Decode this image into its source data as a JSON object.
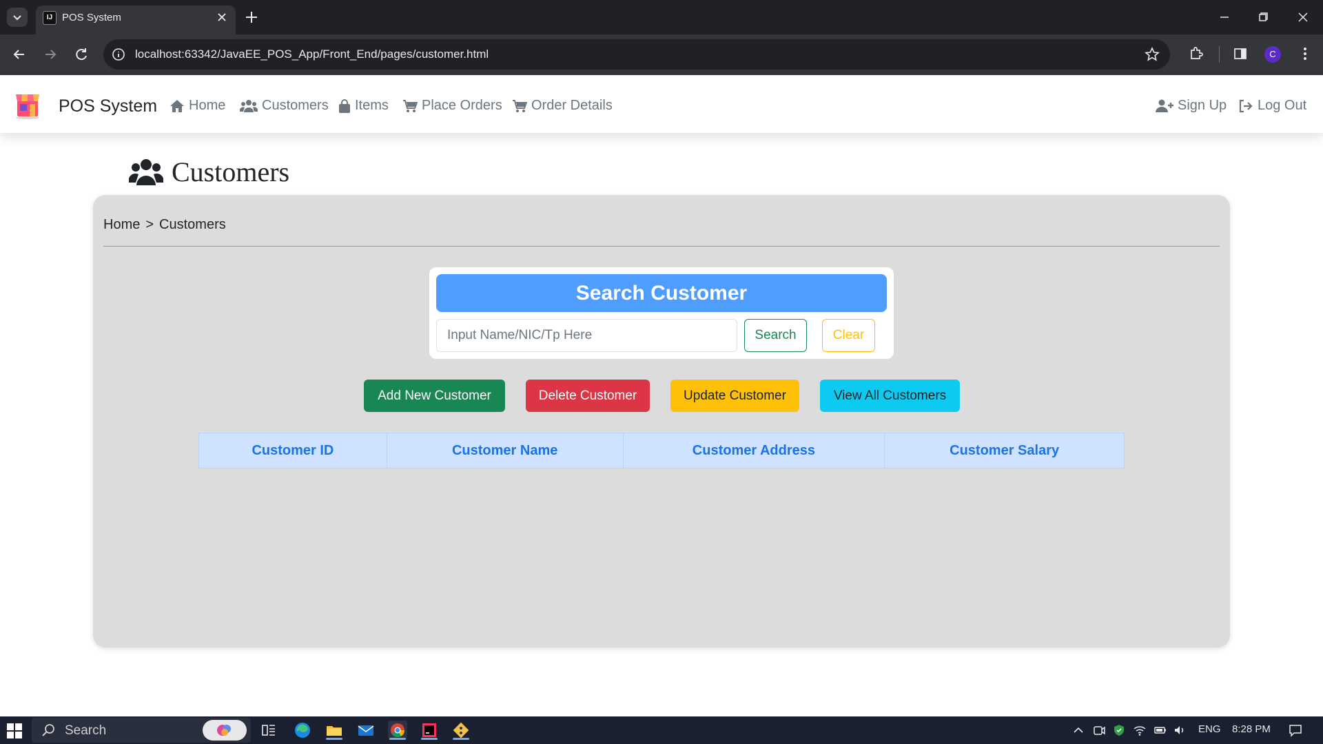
{
  "browser": {
    "tab_title": "POS System",
    "url": "localhost:63342/JavaEE_POS_App/Front_End/pages/customer.html",
    "profile_initial": "C",
    "favicon_text": "IJ"
  },
  "navbar": {
    "brand": "POS System",
    "links": [
      {
        "label": "Home",
        "icon": "home-icon"
      },
      {
        "label": "Customers",
        "icon": "users-icon"
      },
      {
        "label": "Items",
        "icon": "bag-icon"
      },
      {
        "label": "Place Orders",
        "icon": "cart-icon"
      },
      {
        "label": "Order Details",
        "icon": "cart-icon"
      }
    ],
    "right_links": [
      {
        "label": "Sign Up",
        "icon": "user-plus-icon"
      },
      {
        "label": "Log Out",
        "icon": "logout-icon"
      }
    ]
  },
  "page": {
    "title": "Customers",
    "breadcrumb": [
      "Home",
      ">",
      "Customers"
    ]
  },
  "search": {
    "header": "Search Customer",
    "placeholder": "Input Name/NIC/Tp Here",
    "value": "",
    "search_label": "Search",
    "clear_label": "Clear"
  },
  "actions": {
    "add": "Add New Customer",
    "delete": "Delete Customer",
    "update": "Update Customer",
    "view_all": "View All Customers"
  },
  "table": {
    "headers": [
      "Customer ID",
      "Customer Name",
      "Customer Address",
      "Customer Salary"
    ],
    "rows": []
  },
  "taskbar": {
    "search_placeholder": "Search",
    "language": "ENG",
    "time": "8:28 PM"
  },
  "colors": {
    "search_header": "#4f9dfc",
    "add": "#198754",
    "delete": "#dc3545",
    "update": "#ffc107",
    "view_all": "#0dcaf0",
    "table_header_bg": "#cfe2ff",
    "table_header_text": "#1a73e8"
  }
}
